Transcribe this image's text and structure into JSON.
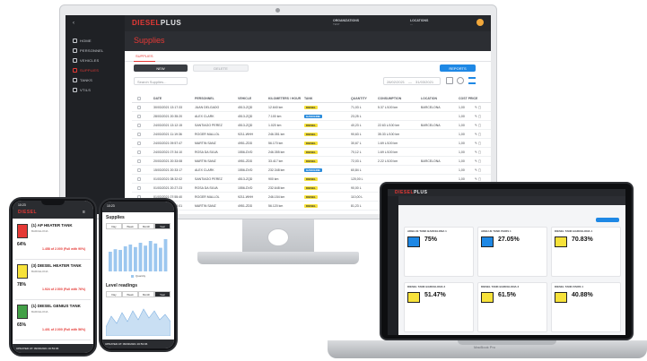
{
  "brand": {
    "logo_a": "DIESEL",
    "logo_b": "PLUS",
    "accent": "#e53935"
  },
  "desktop": {
    "sidebar": {
      "items": [
        "HOME",
        "PERSONNEL",
        "VEHICLES",
        "SUPPLIES",
        "TANKS",
        "VTILS"
      ]
    },
    "topbar": {
      "org_label": "ORGANIZATIONS",
      "org_value": "TEST",
      "loc_label": "LOCATIONS",
      "loc_value": "---"
    },
    "page_title": "Supplies",
    "tab_label": "SUPPLIES",
    "new_button": "NEW",
    "delete_button": "DELETE",
    "reports_button": "REPORTS",
    "search_placeholder": "Search Supplies...",
    "date_from": "28/02/2021",
    "date_to": "31/03/2021",
    "columns": [
      "DATE",
      "PERSONNEL",
      "VEHICLE",
      "KILOMETERS / HOUR",
      "TANK",
      "QUANTITY",
      "CONSUMPTION",
      "LOCATION",
      "COST PRICE"
    ],
    "rows": [
      {
        "date": "30/03/2021 13:17:33",
        "person": "JUAN DELGADO",
        "vehicle": "4513-ZQD",
        "km": "12.640 km",
        "tank": "DIESEL",
        "tank_color": "y",
        "qty": "71,03 L",
        "cons": "5.37 L/100 km",
        "loc": "BARCELONA",
        "cost": "1,00"
      },
      {
        "date": "28/03/2021 20:35:20",
        "person": "ALEX CLARK",
        "vehicle": "4513-ZQD",
        "km": "7.100 km",
        "tank": "GASOLINE",
        "tank_color": "b",
        "qty": "23,25 L",
        "cons": "",
        "loc": "",
        "cost": "1,00"
      },
      {
        "date": "24/03/2021 13:12:15",
        "person": "SANTIAGO PEREZ",
        "vehicle": "4513-ZQD",
        "km": "1.020 km",
        "tank": "DIESEL",
        "tank_color": "y",
        "qty": "40,23 L",
        "cons": "22.63 L/100 km",
        "loc": "BARCELONA",
        "cost": "1,00"
      },
      {
        "date": "24/03/2021 11:19:36",
        "person": "ROGER MALLOL",
        "vehicle": "9211-WHH",
        "km": "246.351 km",
        "tank": "DIESEL",
        "tank_color": "y",
        "qty": "90,63 L",
        "cons": "35.33 L/100 km",
        "loc": "",
        "cost": "1,00"
      },
      {
        "date": "24/03/2021 09:57:47",
        "person": "MARTIN SANZ",
        "vehicle": "4951-ZDD",
        "km": "56.170 km",
        "tank": "DIESEL",
        "tank_color": "y",
        "qty": "30,67 L",
        "cons": "1.69 L/100 km",
        "loc": "",
        "cost": "1,00"
      },
      {
        "date": "24/03/2021 07:34:10",
        "person": "ROSA DA SILVA",
        "vehicle": "1556-DVD",
        "km": "246.355 km",
        "tank": "DIESEL",
        "tank_color": "y",
        "qty": "70,12 L",
        "cons": "1.69 L/100 km",
        "loc": "",
        "cost": "1,00"
      },
      {
        "date": "20/03/2021 20:33:08",
        "person": "MARTIN SANZ",
        "vehicle": "4951-ZDD",
        "km": "33.417 km",
        "tank": "DIESEL",
        "tank_color": "y",
        "qty": "72,03 L",
        "cons": "2.22 L/100 km",
        "loc": "BARCELONA",
        "cost": "1,00"
      },
      {
        "date": "15/03/2021 20:33:17",
        "person": "ALEX CLARK",
        "vehicle": "1556-DVD",
        "km": "232.348 km",
        "tank": "GASOLINE",
        "tank_color": "b",
        "qty": "60,84 L",
        "cons": "",
        "loc": "",
        "cost": "1,00"
      },
      {
        "date": "01/03/2021 08:32:02",
        "person": "SANTIAGO PEREZ",
        "vehicle": "4513-ZQD",
        "km": "900 km",
        "tank": "DIESEL",
        "tank_color": "y",
        "qty": "120,00 L",
        "cons": "",
        "loc": "",
        "cost": "1,00"
      },
      {
        "date": "01/03/2021 20:27:23",
        "person": "ROSA DA SILVA",
        "vehicle": "1556-DVD",
        "km": "232.648 km",
        "tank": "DIESEL",
        "tank_color": "y",
        "qty": "90,00 L",
        "cons": "",
        "loc": "",
        "cost": "1,00"
      },
      {
        "date": "01/03/2021 07:55:40",
        "person": "ROGER MALLOL",
        "vehicle": "9211-WHH",
        "km": "246.154 km",
        "tank": "DIESEL",
        "tank_color": "y",
        "qty": "110,00 L",
        "cons": "",
        "loc": "",
        "cost": "1,00"
      },
      {
        "date": "01/03/2021 20:33:01",
        "person": "MARTIN SANZ",
        "vehicle": "4951-ZDD",
        "km": "56.120 km",
        "tank": "DIESEL",
        "tank_color": "y",
        "qty": "81,23 L",
        "cons": "",
        "loc": "",
        "cost": "1,00"
      }
    ]
  },
  "phone1": {
    "time": "10:23",
    "tanks": [
      {
        "name": "(1) AP HEATER TANK",
        "loc": "BARCELONA",
        "pct": "64%",
        "qty": "1.458 of 2.000 (Full with 90%)",
        "color": "#e53935"
      },
      {
        "name": "(3) DIESEL HEATER TANK",
        "loc": "BARCELONA",
        "pct": "78%",
        "qty": "1.924 of 2.500 (Full with 76%)",
        "color": "#f7e23a"
      },
      {
        "name": "(1) DIESEL GENIUS TANK",
        "loc": "BARCELONA",
        "pct": "65%",
        "qty": "1.401 of 2.000 (Full with 56%)",
        "color": "#43a047"
      }
    ],
    "footer": "UPDATED AT: 09/03/2021 16:53:06"
  },
  "phone2": {
    "time": "10:23",
    "supplies_title": "Supplies",
    "periods": [
      "Day",
      "Week",
      "Month",
      "Year"
    ],
    "legend": "Quantity",
    "levels_title": "Level readings",
    "footer": "UPDATED AT: 09/03/2021 16:53:06"
  },
  "laptop": {
    "cards": [
      {
        "name": "ADBLUE TANK BARCELONA 1",
        "pct": "75%",
        "color": "#1e88e5"
      },
      {
        "name": "ADBLUE TANK PARIS 1",
        "pct": "27.05%",
        "color": "#1e88e5"
      },
      {
        "name": "DIESEL TANK BARCELONA 1",
        "pct": "70.83%",
        "color": "#f7e23a"
      },
      {
        "name": "DIESEL TANK BARCELONA 2",
        "pct": "51.47%",
        "color": "#f7e23a"
      },
      {
        "name": "DIESEL TANK BARCELONA 3",
        "pct": "61.5%",
        "color": "#f7e23a"
      },
      {
        "name": "DIESEL TANK PARIS 1",
        "pct": "40.88%",
        "color": "#f7e23a"
      }
    ],
    "brand_label": "MacBook Pro"
  }
}
